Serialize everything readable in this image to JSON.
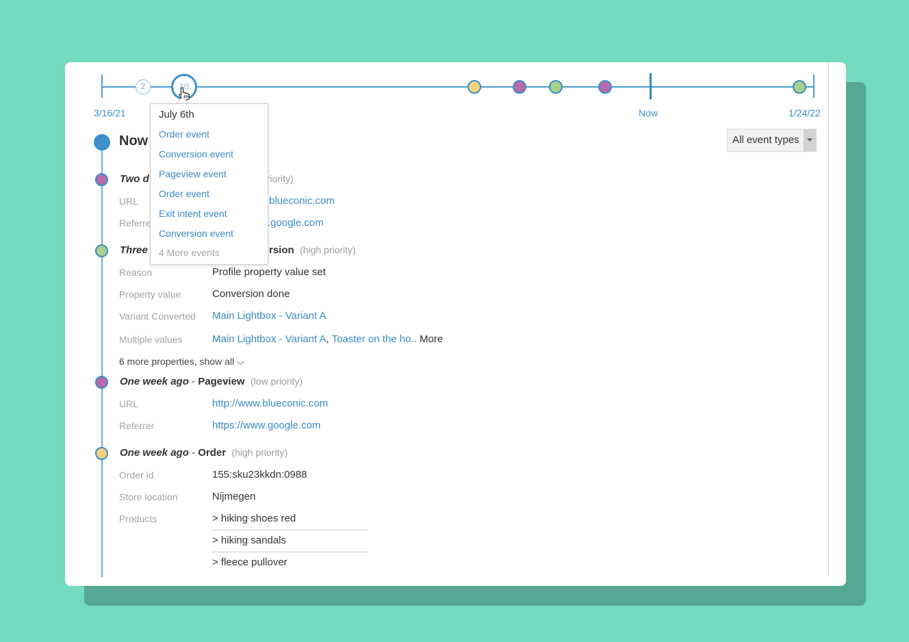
{
  "timeline": {
    "start_label": "3/16/21",
    "now_label": "Now",
    "end_label": "1/24/22",
    "cluster_small_count": "2",
    "cluster_big_count": "10"
  },
  "filter": {
    "selected": "All event types"
  },
  "now_heading": "Now",
  "popup": {
    "title": "July 6th",
    "items": [
      "Order event",
      "Conversion event",
      "Pageview event",
      "Order event",
      "Exit intent event",
      "Conversion event"
    ],
    "more": "4 More events"
  },
  "events": [
    {
      "when": "Two d",
      "type": "",
      "priority": "priority)",
      "props": [
        {
          "label": "URL",
          "value": "blueconic.com"
        },
        {
          "label": "Referre",
          "value": ".google.com"
        }
      ]
    },
    {
      "when": "Three",
      "type": "rsion",
      "priority": "(high priority)",
      "props": [
        {
          "label": "Reason",
          "value": "Profile property value set"
        },
        {
          "label": "Property value",
          "value": "Conversion done"
        },
        {
          "label": "Variant Converted",
          "value": "Main Lightbox - Variant A"
        },
        {
          "label": "Multiple values",
          "value1": "Main Lightbox - Variant A",
          "sep": ", ",
          "value2": "Toaster on the ho..",
          "more": " More"
        }
      ],
      "more_props": "6 more properties, show all ⌵"
    },
    {
      "when": "One week ago",
      "dash": " - ",
      "type": "Pageview",
      "priority": "(low priority)",
      "props": [
        {
          "label": "URL",
          "value": "http://www.blueconic.com"
        },
        {
          "label": "Referrer",
          "value": "https://www.google.com"
        }
      ]
    },
    {
      "when": "One week ago",
      "dash": " - ",
      "type": "Order",
      "priority": "(high priority)",
      "props": [
        {
          "label": "Order id",
          "value": "155:sku23kkdn:0988"
        },
        {
          "label": "Store location",
          "value": "Nijmegen"
        },
        {
          "label": "Products"
        }
      ],
      "products": [
        "> hiking shoes red",
        "> hiking sandals",
        "> fleece pullover"
      ]
    }
  ],
  "colors": {
    "background": "#74dac0",
    "card_shadow": "#55a893",
    "accent_blue": "#3b8ec8",
    "link_blue": "#3a8ac4",
    "dot_yellow": "#f4d27e",
    "dot_purple": "#b86aab",
    "dot_green": "#a8d08a"
  },
  "icons": {
    "cursor": "hand-pointer-icon",
    "dropdown": "caret-down-icon"
  }
}
